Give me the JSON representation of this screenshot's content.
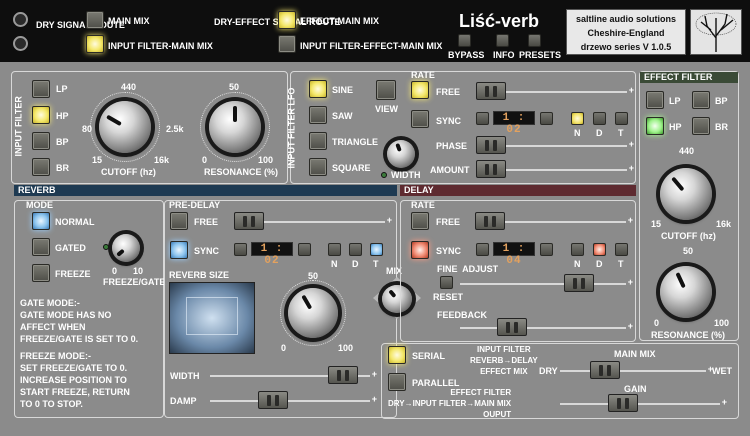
{
  "top": {
    "dry_signal_route": "DRY\nSIGNAL\nROUTE",
    "main_mix": "MAIN MIX",
    "input_filter_main_mix": "INPUT FILTER-MAIN MIX",
    "dry_effect_signal_route": "DRY-EFFECT\nSIGNAL\nROUTE",
    "effect_main_mix": "EFFECT-MAIN MIX",
    "input_filter_effect_main_mix": "INPUT FILTER-EFFECT-MAIN MIX",
    "title": "Liść-verb",
    "brand_line1": "saltline audio solutions",
    "brand_line2": "Cheshire-England",
    "brand_line3": "drzewo series V 1.0.5",
    "bypass": "BYPASS",
    "info": "INFO",
    "presets": "PRESETS"
  },
  "input_filter": {
    "title": "INPUT FILTER",
    "lp": "LP",
    "hp": "HP",
    "bp": "BP",
    "br": "BR",
    "cutoff_label": "CUTOFF (hz)",
    "cutoff_top": "440",
    "cutoff_left": "80",
    "cutoff_right": "2.5k",
    "cutoff_min": "15",
    "cutoff_max": "16k",
    "res_label": "RESONANCE (%)",
    "res_top": "50",
    "res_min": "0",
    "res_max": "100"
  },
  "lfo": {
    "title": "INPUT FILTER LFO",
    "sine": "SINE",
    "saw": "SAW",
    "triangle": "TRIANGLE",
    "square": "SQUARE",
    "view": "VIEW",
    "rate": "RATE",
    "free": "FREE",
    "sync": "SYNC",
    "sync_value": "1 : 02",
    "n": "N",
    "d": "D",
    "t": "T",
    "phase": "PHASE",
    "amount": "AMOUNT",
    "width": "WIDTH"
  },
  "effect_filter": {
    "title": "EFFECT FILTER",
    "lp": "LP",
    "bp": "BP",
    "hp": "HP",
    "br": "BR",
    "cutoff_top": "440",
    "cutoff_min": "15",
    "cutoff_max": "16k",
    "cutoff_label": "CUTOFF (hz)",
    "res_top": "50",
    "res_min": "0",
    "res_max": "100",
    "res_label": "RESONANCE (%)"
  },
  "reverb": {
    "title": "REVERB",
    "mode": "MODE",
    "normal": "NORMAL",
    "gated": "GATED",
    "freeze": "FREEZE",
    "freeze_gate": "FREEZE/GATE",
    "fg_min": "0",
    "fg_max": "10",
    "pre_delay": "PRE-DELAY",
    "free": "FREE",
    "sync": "SYNC",
    "sync_value": "1 : 02",
    "n": "N",
    "d": "D",
    "t": "T",
    "gate_help": "GATE MODE:-\nGATE MODE HAS NO\nAFFECT WHEN\nFREEZE/GATE IS SET TO 0.",
    "freeze_help": "FREEZE MODE:-\nSET FREEZE/GATE TO 0.\nINCREASE POSITION TO\nSTART FREEZE, RETURN\nTO 0 TO STOP.",
    "size_label": "REVERB SIZE",
    "size_top": "50",
    "size_min": "0",
    "size_max": "100",
    "width": "WIDTH",
    "damp": "DAMP"
  },
  "mix": {
    "label": "MIX"
  },
  "delay": {
    "title": "DELAY",
    "rate": "RATE",
    "free": "FREE",
    "sync": "SYNC",
    "sync_value": "1 : 04",
    "n": "N",
    "d": "D",
    "t": "T",
    "fine_adjust": "FINE  ADJUST",
    "reset": "RESET",
    "feedback": "FEEDBACK"
  },
  "routing": {
    "serial": "SERIAL",
    "parallel": "PARALLEL",
    "serial_desc": "INPUT FILTER\nREVERB→DELAY\nEFFECT MIX",
    "parallel_desc": "EFFECT FILTER\nDRY→INPUT FILTER→MAIN MIX\nOUPUT",
    "main_mix": "MAIN MIX",
    "dry": "DRY",
    "wet": "WET",
    "gain": "GAIN"
  },
  "colors": {
    "reverb_header": "#1e3a52",
    "delay_header": "#5e2a30",
    "effect_filter_header": "#3a4a36",
    "sync_display": "#e3a15e"
  }
}
